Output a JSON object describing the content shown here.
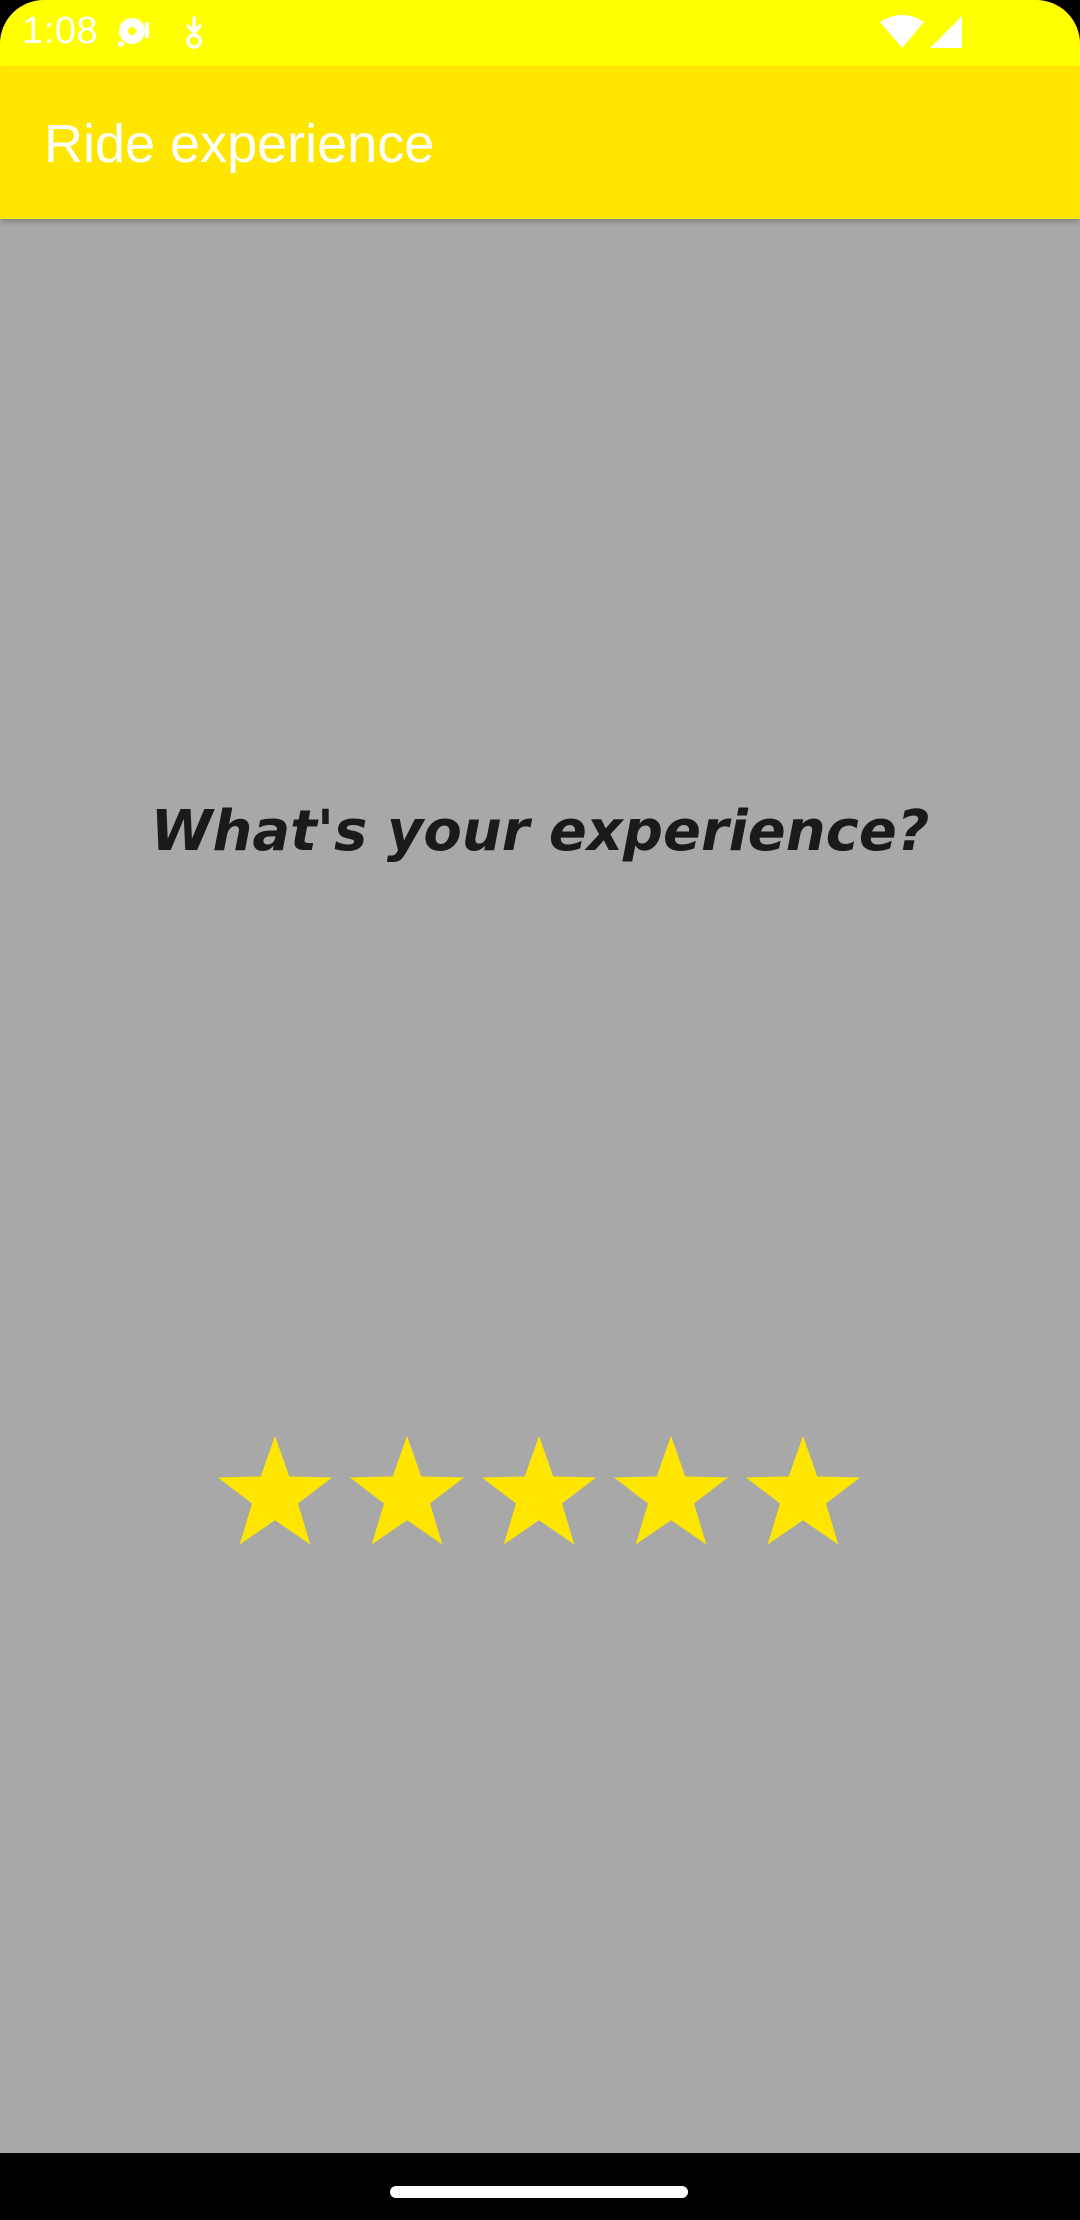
{
  "status_bar": {
    "time": "1:08",
    "left_icons": [
      "media-icon",
      "download-icon"
    ],
    "right_icons": [
      "wifi-icon",
      "cell-signal-icon"
    ]
  },
  "app_bar": {
    "title": "Ride experience"
  },
  "content": {
    "question": "What's your experience?",
    "rating": {
      "max_stars": 5,
      "selected": 5
    }
  },
  "colors": {
    "status_bar": "#ffff00",
    "app_bar": "#fee600",
    "background": "#a8a8a8",
    "star": "#fee600",
    "question_text": "#1a1a1a"
  }
}
